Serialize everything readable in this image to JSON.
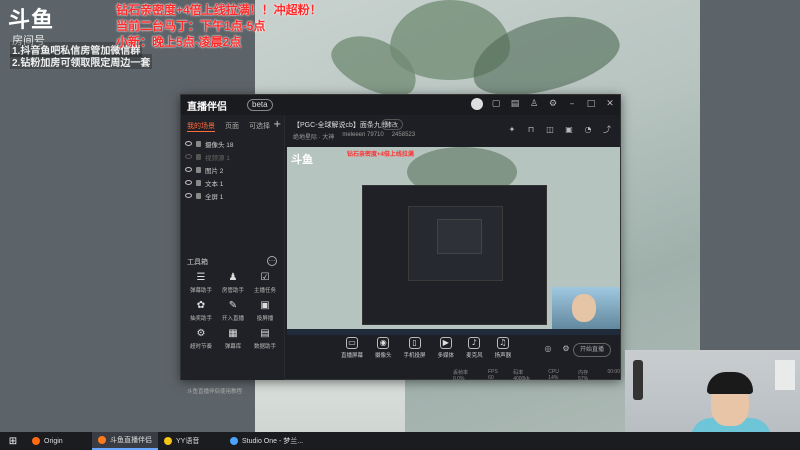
{
  "overlay": {
    "logo": "斗鱼",
    "logo_sub": "房间号",
    "promo_lines": [
      "1.抖音鱼吧私信房管加微信群",
      "2.钻粉加房可领取限定周边一套"
    ],
    "notices": [
      "钻石亲密度+4倍上线拉满！！冲超粉！",
      "当前二台马丁：下午1点-5点",
      "小新：晚上5点-凌晨2点"
    ]
  },
  "app": {
    "logo": "直播伴侣",
    "version_badge": "beta",
    "titlebar_icons": [
      "avatar",
      "message-icon",
      "gift-icon",
      "shirt-icon",
      "settings-icon",
      "minimize-icon",
      "maximize-icon",
      "close-icon"
    ],
    "tabs": [
      "我的场景",
      "页面",
      "可选择"
    ],
    "scenes": [
      {
        "name": "摄像头 18",
        "dim": false
      },
      {
        "name": "视频源 1",
        "dim": true
      },
      {
        "name": "图片 2",
        "dim": false
      },
      {
        "name": "文本 1",
        "dim": false
      },
      {
        "name": "全屏 1",
        "dim": false
      }
    ],
    "tools_header": "工具箱",
    "tools": [
      {
        "label": "弹幕助手",
        "icon": "☰"
      },
      {
        "label": "房管助手",
        "icon": "♟"
      },
      {
        "label": "主播任务",
        "icon": "☑"
      },
      {
        "label": "抽奖助手",
        "icon": "✿"
      },
      {
        "label": "开入直播",
        "icon": "✎"
      },
      {
        "label": "投屏播",
        "icon": "▣"
      },
      {
        "label": "超时节奏",
        "icon": "⚙"
      },
      {
        "label": "弹幕库",
        "icon": "▦"
      },
      {
        "label": "数据助手",
        "icon": "▤"
      },
      {
        "label": "斗鱼直播伴侣使用教程",
        "icon": "⬇"
      },
      {
        "label": "",
        "icon": "▲"
      }
    ],
    "room": {
      "title": "【PGC-全球解说cb】面条九郎！",
      "edit_btn": "修改",
      "meta": [
        "绝地星际 · 大神",
        "meleeen 79710",
        "2458523"
      ]
    },
    "right_icons": [
      "gift-icon",
      "lock-icon",
      "cart-icon",
      "gift-box-icon",
      "bell-icon",
      "share-icon"
    ],
    "bottom_controls": [
      {
        "label": "直播屏幕",
        "icon": "▭"
      },
      {
        "label": "摄像头",
        "icon": "◉"
      },
      {
        "label": "手机投屏",
        "icon": "▯"
      },
      {
        "label": "多媒体",
        "icon": "▶"
      },
      {
        "label": "麦克风",
        "icon": "♪"
      },
      {
        "label": "扬声器",
        "icon": "♫"
      }
    ],
    "start_button": "开始直播",
    "status": [
      "丢帧率 0.0%",
      "FPS 60",
      "码率 4000kb",
      "CPU 14%",
      "内存 57%",
      "00:00"
    ]
  },
  "preview": {
    "logo": "斗鱼",
    "notice_text": "钻石亲密度+4倍上线拉满"
  },
  "taskbar": {
    "items": [
      {
        "label": "Origin",
        "color": "#ff6a13",
        "active": false
      },
      {
        "label": "斗鱼直播伴侣",
        "color": "#ff7a1a",
        "active": true
      },
      {
        "label": "YY语音",
        "color": "#f5c518",
        "active": false
      },
      {
        "label": "Studio One - 梦兰...",
        "color": "#4aa3ff",
        "active": false
      }
    ]
  }
}
